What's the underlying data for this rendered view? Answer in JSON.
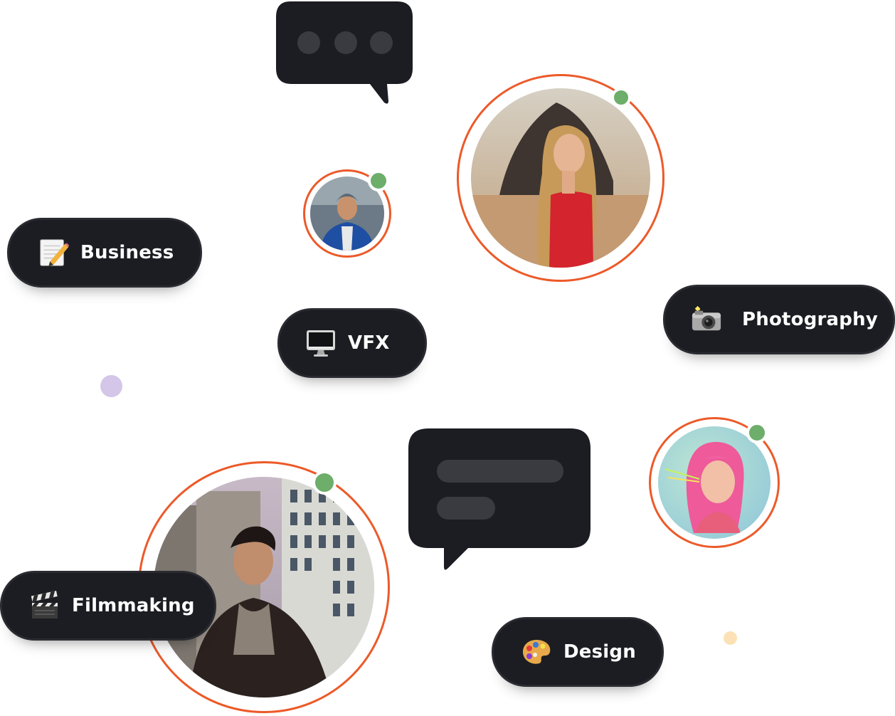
{
  "categories": [
    {
      "label": "Business",
      "icon": "memo-pencil-icon"
    },
    {
      "label": "VFX",
      "icon": "desktop-computer-icon"
    },
    {
      "label": "Photography",
      "icon": "camera-flash-icon"
    },
    {
      "label": "Filmmaking",
      "icon": "clapper-board-icon"
    },
    {
      "label": "Design",
      "icon": "artist-palette-icon"
    }
  ],
  "colors": {
    "pill_background": "#1c1d22",
    "pill_text": "#ffffff",
    "avatar_ring": "#ec5a29",
    "online_status": "#6dae6a",
    "bubble": "#1c1d22",
    "bubble_content": "#3a3b40",
    "dot_purple": "#d3c6e8",
    "dot_yellow": "#fbe1b5"
  },
  "avatars": [
    {
      "name": "avatar-woman-red-top",
      "online": true
    },
    {
      "name": "avatar-man-blue-jacket",
      "online": true
    },
    {
      "name": "avatar-woman-pink-hair",
      "online": true
    },
    {
      "name": "avatar-man-rooftop",
      "online": true
    }
  ],
  "bubbles": [
    {
      "name": "typing-bubble",
      "icon": "typing-dots-icon"
    },
    {
      "name": "message-bubble",
      "icon": "message-lines-icon"
    }
  ]
}
